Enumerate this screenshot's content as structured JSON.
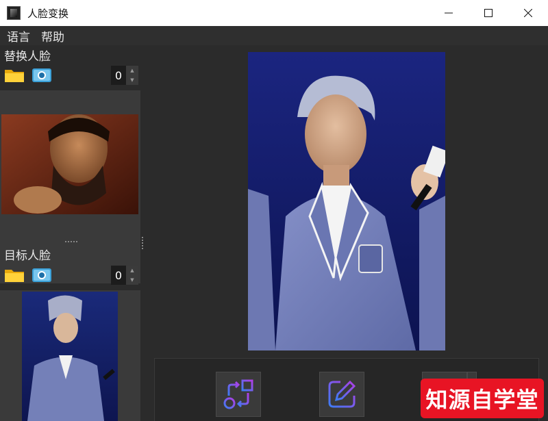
{
  "window": {
    "title": "人脸变换"
  },
  "menu": {
    "items": [
      {
        "label": "语言"
      },
      {
        "label": "帮助"
      }
    ]
  },
  "source_face": {
    "title": "替换人脸",
    "index": "0"
  },
  "target_face": {
    "title": "目标人脸",
    "index": "0"
  },
  "watermark": {
    "text": "知源自学堂"
  },
  "colors": {
    "accent_start": "#3d7cf2",
    "accent_end": "#b03ee6",
    "watermark_bg": "#e81424"
  },
  "icons": [
    "folder-icon",
    "camera-icon",
    "swap-icon",
    "edit-icon"
  ]
}
